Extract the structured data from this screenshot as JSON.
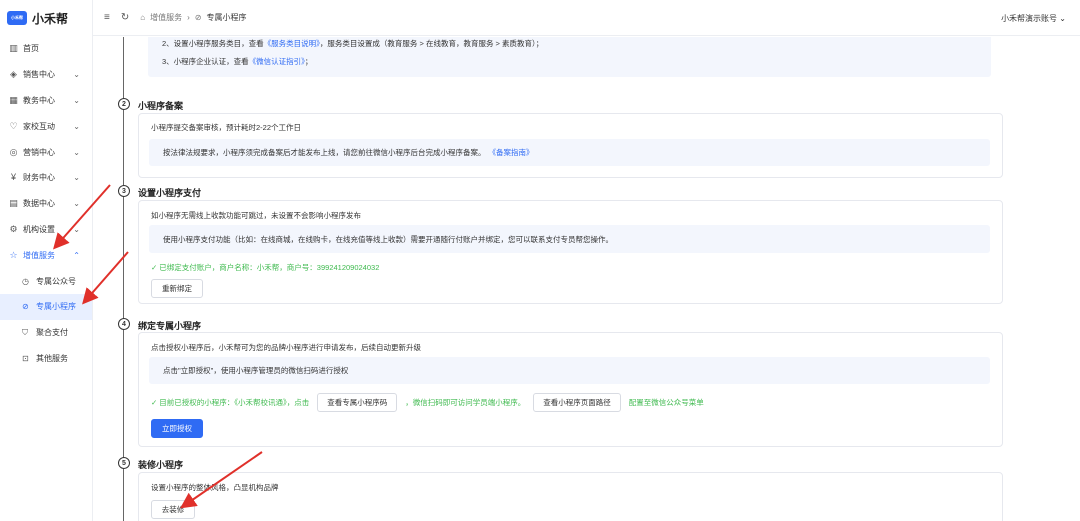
{
  "app": {
    "name": "小禾帮",
    "logo_text": "小禾帮"
  },
  "sidebar": {
    "items": [
      {
        "label": "首页",
        "icon": "bar-chart-icon"
      },
      {
        "label": "销售中心",
        "icon": "cube-icon"
      },
      {
        "label": "教务中心",
        "icon": "grid-icon"
      },
      {
        "label": "家校互动",
        "icon": "heart-icon"
      },
      {
        "label": "营销中心",
        "icon": "megaphone-icon"
      },
      {
        "label": "财务中心",
        "icon": "yen-icon"
      },
      {
        "label": "数据中心",
        "icon": "chart-icon"
      },
      {
        "label": "机构设置",
        "icon": "gear-icon"
      },
      {
        "label": "增值服务",
        "icon": "star-icon"
      }
    ],
    "sub_items": [
      {
        "label": "专属公众号",
        "icon": "clock-icon"
      },
      {
        "label": "专属小程序",
        "icon": "compass-icon"
      },
      {
        "label": "聚合支付",
        "icon": "shield-icon"
      },
      {
        "label": "其他服务",
        "icon": "box-icon"
      }
    ]
  },
  "header": {
    "breadcrumb": [
      "增值服务",
      "专属小程序"
    ],
    "account": "小禾帮演示账号"
  },
  "step1": {
    "line2_prefix": "2、设置小程序服务类目，查看",
    "line2_link": "《服务类目说明》",
    "line2_suffix": "，服务类目设置成（教育服务 > 在线教育，教育服务 > 素质教育）；",
    "line3_prefix": "3、小程序企业认证，查看",
    "line3_link": "《微信认证指引》",
    "line3_suffix": "；"
  },
  "step2": {
    "num": "2",
    "title": "小程序备案",
    "desc": "小程序提交备案审核，预计耗时2-22个工作日",
    "tip": "按法律法规要求，小程序须完成备案后才能发布上线，请您前往微信小程序后台完成小程序备案。",
    "tip_link": "《备案指南》"
  },
  "step3": {
    "num": "3",
    "title": "设置小程序支付",
    "desc": "如小程序无需线上收款功能可跳过，未设置不会影响小程序发布",
    "tip": "使用小程序支付功能（比如：在线商城，在线购卡，在线充值等线上收款）需要开通随行付账户并绑定，您可以联系支付专员帮您操作。",
    "status": "已绑定支付账户，商户名称：小禾帮，商户号：399241209024032",
    "rebind_button": "重新绑定"
  },
  "step4": {
    "num": "4",
    "title": "绑定专属小程序",
    "desc": "点击授权小程序后，小禾帮可为您的品牌小程序进行申请发布，后续自动更新升级",
    "tip": "点击\"立即授权\"，使用小程序管理员的微信扫码进行授权",
    "status_prefix": "目前已授权的小程序：《小禾帮校讯通》，点击",
    "view_code_button": "查看专属小程序码",
    "status_mid": "，微信扫码即可访问学员端小程序。",
    "view_path_button": "查看小程序页面路径",
    "status_suffix": "配置至微信公众号菜单",
    "authorize_button": "立即授权"
  },
  "step5": {
    "num": "5",
    "title": "装修小程序",
    "desc": "设置小程序的整体风格，凸显机构品牌",
    "decorate_button": "去装修"
  },
  "colors": {
    "accent": "#2f6bf4",
    "success": "#3fba4f",
    "annotation": "#e0302a"
  }
}
